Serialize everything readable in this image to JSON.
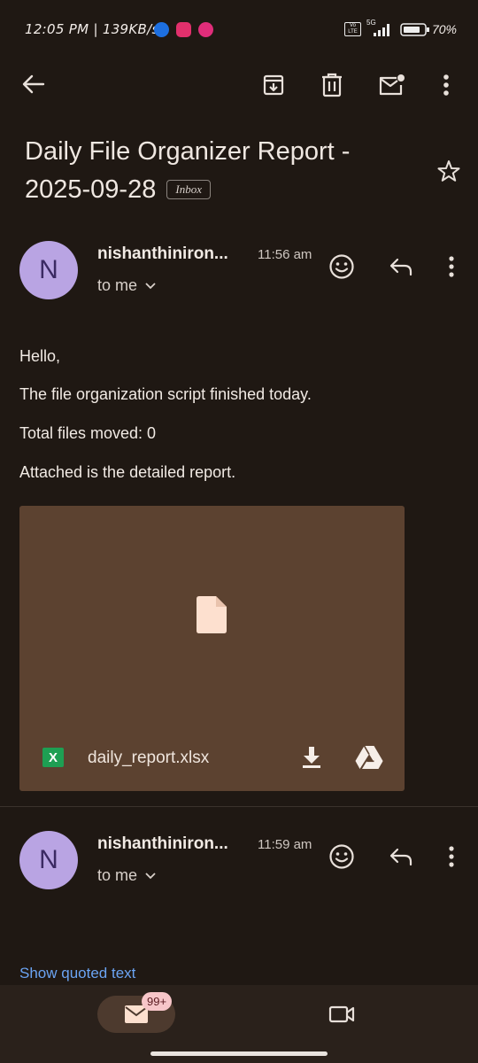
{
  "status_bar": {
    "time_text": "12:05 PM | 139KB/s",
    "network_label": "Vo LTE",
    "network_gen": "5G",
    "battery": "70%"
  },
  "toolbar": {
    "icons": [
      "back-arrow-icon",
      "archive-icon",
      "delete-icon",
      "mark-unread-icon",
      "more-vert-icon"
    ]
  },
  "email": {
    "subject": "Daily File Organizer Report - 2025-09-28",
    "label": "Inbox"
  },
  "messages": [
    {
      "avatar_letter": "N",
      "sender": "nishanthiniron...",
      "time": "11:56 am",
      "recipient": "to me",
      "body": [
        "Hello,",
        "The file organization script finished today.",
        "Total files moved: 0",
        "Attached is the detailed report."
      ],
      "attachment": {
        "type_badge": "X",
        "file_name": "daily_report.xlsx"
      }
    },
    {
      "avatar_letter": "N",
      "sender": "nishanthiniron...",
      "time": "11:59 am",
      "recipient": "to me",
      "show_quoted": "Show quoted text"
    }
  ],
  "bottom_nav": {
    "mail_badge": "99+"
  },
  "colors": {
    "background": "#1f1813",
    "attachment_bg": "#5c4230",
    "avatar": "#b9a4e3",
    "link": "#6ba4f3"
  }
}
